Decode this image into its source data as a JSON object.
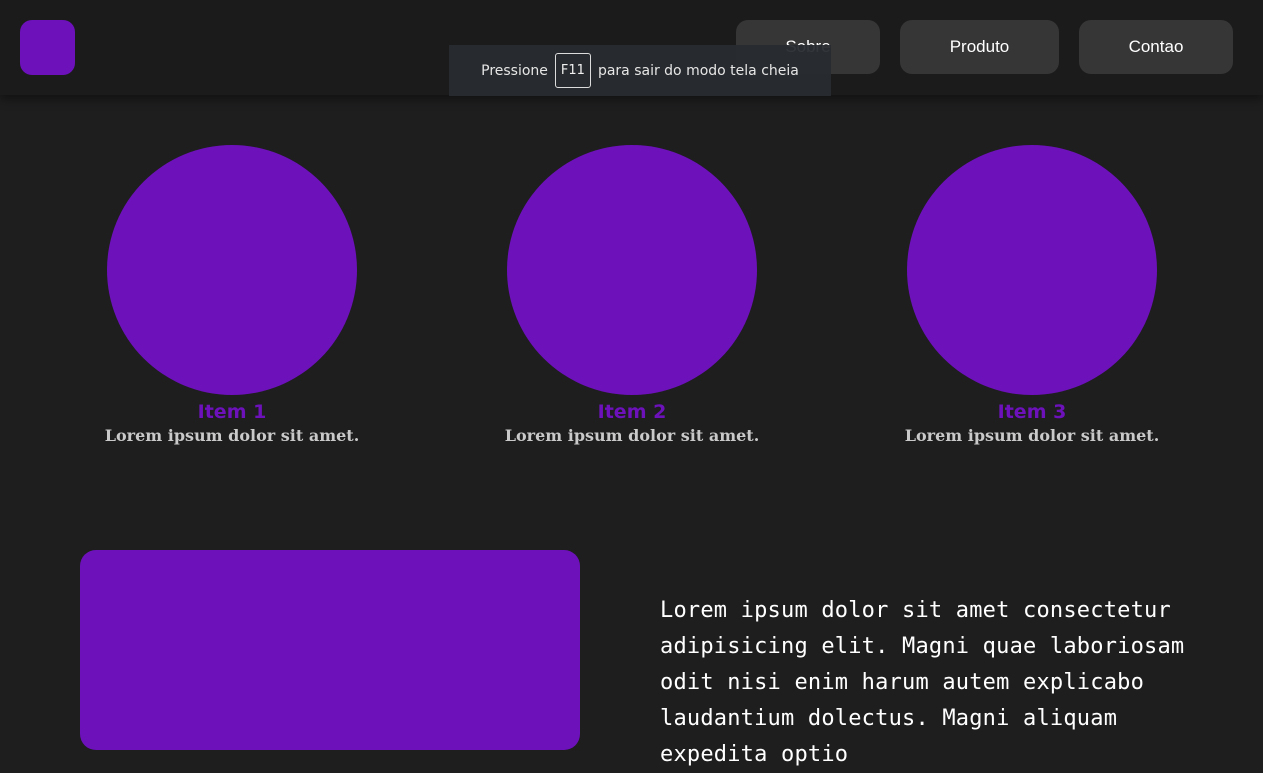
{
  "header": {
    "nav": [
      {
        "label": "Sobre"
      },
      {
        "label": "Produto"
      },
      {
        "label": "Contao"
      }
    ]
  },
  "fullscreen_notice": {
    "before": "Pressione",
    "key": "F11",
    "after": "para sair do modo tela cheia"
  },
  "items": [
    {
      "title": "Item 1",
      "desc": "Lorem ipsum dolor sit amet."
    },
    {
      "title": "Item 2",
      "desc": "Lorem ipsum dolor sit amet."
    },
    {
      "title": "Item 3",
      "desc": "Lorem ipsum dolor sit amet."
    }
  ],
  "feature": {
    "text": "Lorem ipsum dolor sit amet consectetur adipisicing elit. Magni quae laboriosam odit nisi enim harum autem explicabo laudantium dolectus. Magni aliquam expedita optio"
  },
  "colors": {
    "accent": "#6d11bb",
    "background": "#1e1e1f",
    "header": "#1b1b1c",
    "nav_button": "#363636"
  }
}
